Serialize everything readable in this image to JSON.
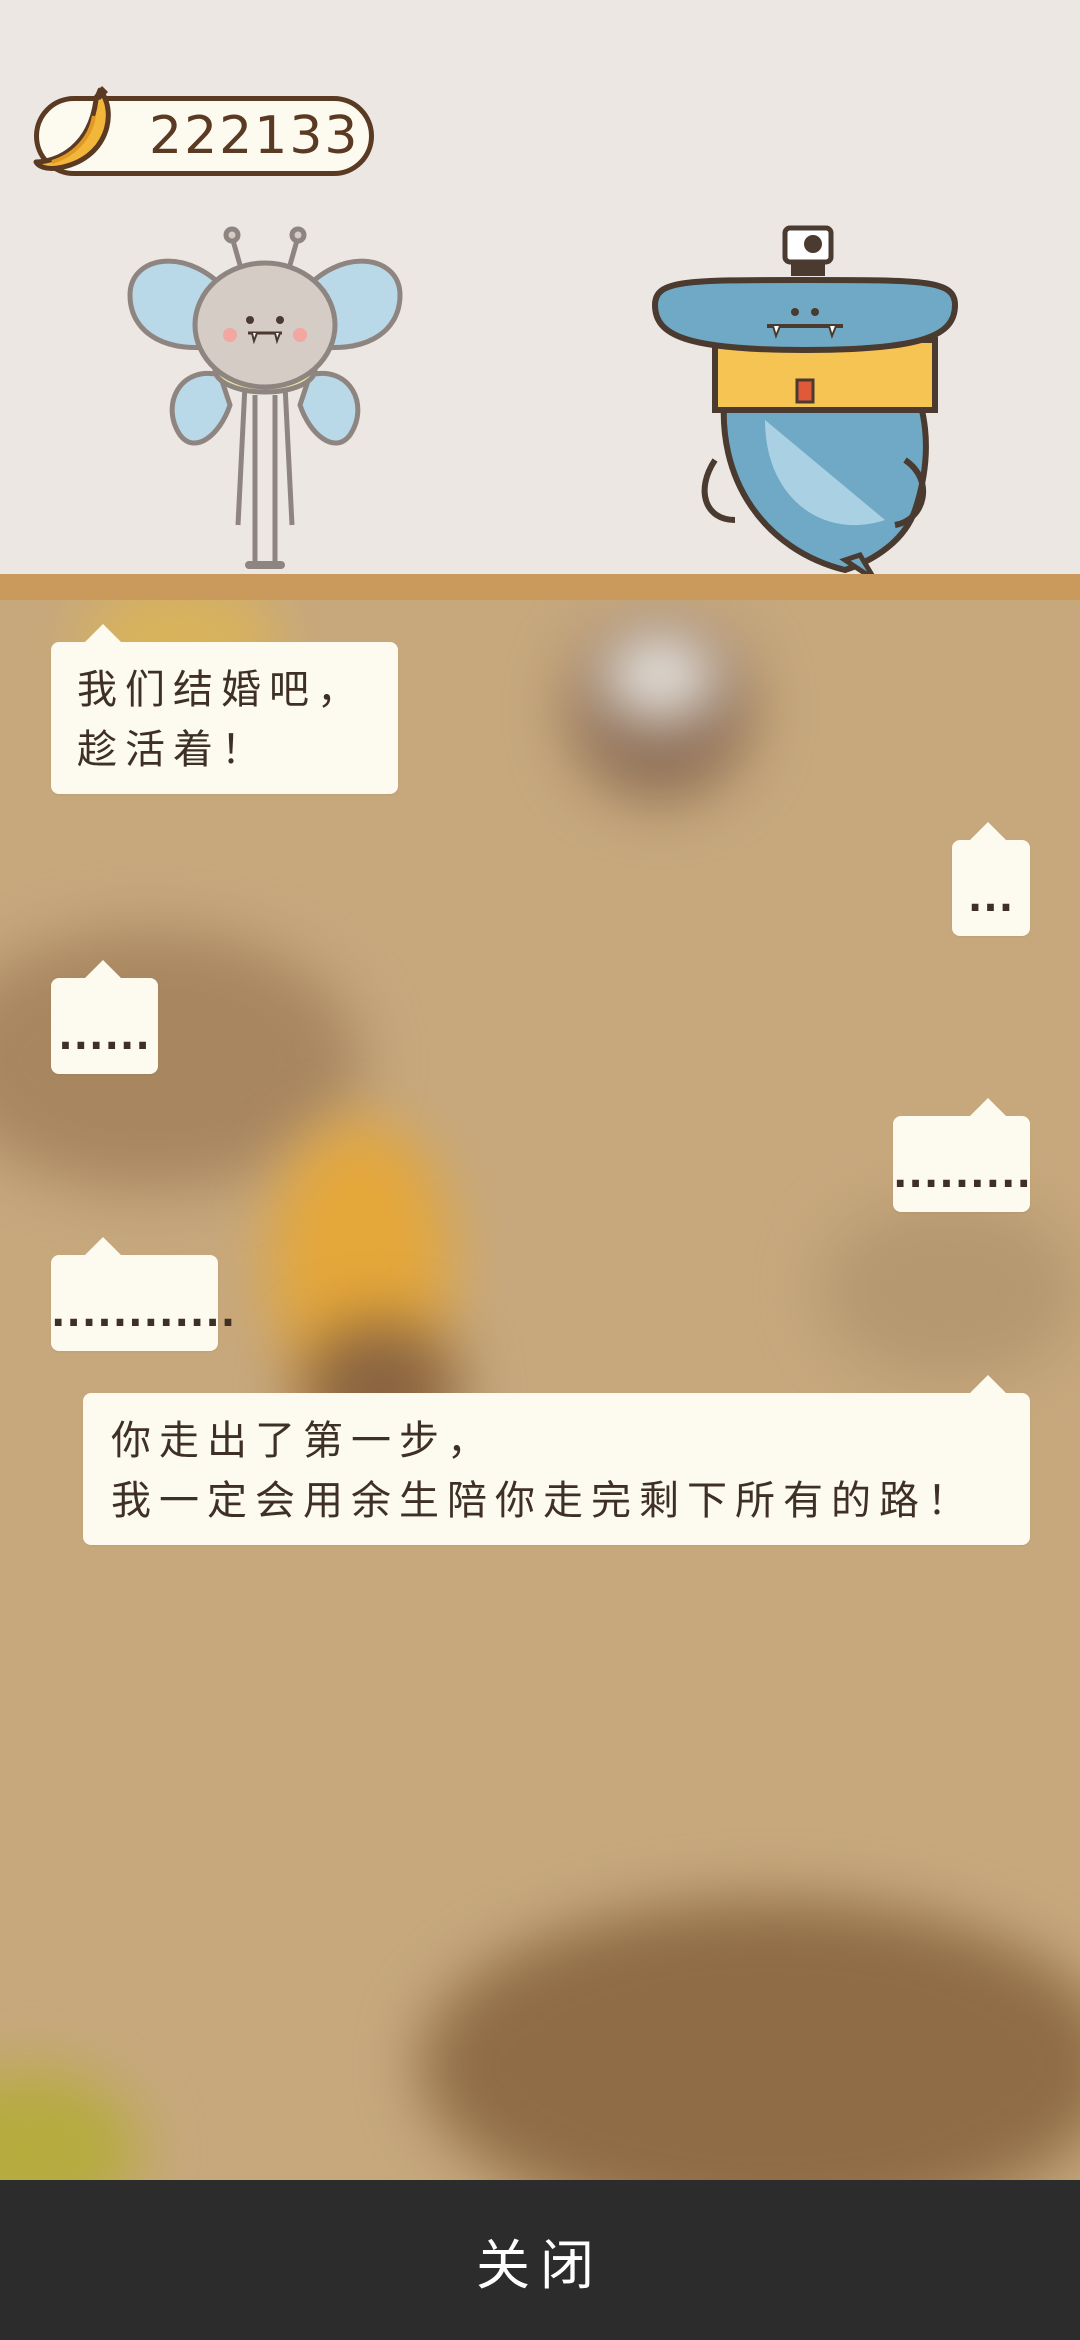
{
  "counter": {
    "icon": "banana-icon",
    "value": "222133"
  },
  "characters": {
    "left": "butterfly-character",
    "right": "hammerhead-shark-character"
  },
  "messages": [
    {
      "side": "left",
      "lines": [
        "我们结婚吧，",
        "趁活着！"
      ]
    },
    {
      "side": "right",
      "lines": [
        "..."
      ]
    },
    {
      "side": "left",
      "lines": [
        "......"
      ]
    },
    {
      "side": "right",
      "lines": [
        "........."
      ]
    },
    {
      "side": "left",
      "lines": [
        "............"
      ]
    },
    {
      "side": "right",
      "lines": [
        "你走出了第一步，",
        "我一定会用余生陪你走完剩下所有的路！"
      ]
    }
  ],
  "bottom_bar": {
    "close_label": "关闭"
  },
  "colors": {
    "stage_bg": "#ece7e2",
    "ledge": "#c99a5c",
    "chat_bg": "#c7a87d",
    "bubble": "#fdfaf0",
    "text": "#3f3026",
    "bottom_bar": "#2c2c2c"
  }
}
